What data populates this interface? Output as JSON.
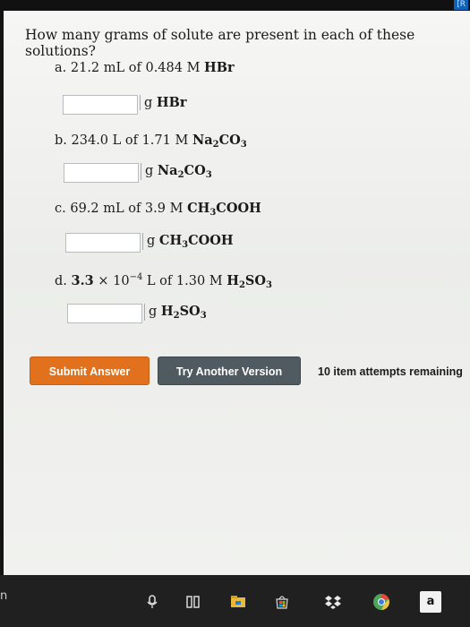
{
  "top_badge": "[R",
  "question": "How many grams of solute are present in each of these solutions?",
  "parts": [
    {
      "letter": "a.",
      "text_before": "21.2 mL of 0.484 M",
      "solute_html": "<b>HBr</b>",
      "answer_value": "",
      "unit_html": "g <b>HBr</b>"
    },
    {
      "letter": "b.",
      "text_before": "234.0 L of 1.71 M",
      "solute_html": "<b>Na<sub>2</sub>CO<sub>3</sub></b>",
      "answer_value": "",
      "unit_html": "g <b>Na<sub>2</sub>CO<sub>3</sub></b>"
    },
    {
      "letter": "c.",
      "text_before": "69.2 mL of 3.9 M",
      "solute_html": "<b>CH<sub>3</sub>COOH</b>",
      "answer_value": "",
      "unit_html": "g <b>CH<sub>3</sub>COOH</b>"
    },
    {
      "letter": "d.",
      "text_before_html": "<b>3.3</b> × 10<sup>−4</sup> L of 1.30 M",
      "solute_html": "<b>H<sub>2</sub>SO<sub>3</sub></b>",
      "answer_value": "",
      "unit_html": "g <b>H<sub>2</sub>SO<sub>3</sub></b>"
    }
  ],
  "buttons": {
    "submit": "Submit Answer",
    "try_another": "Try Another Version"
  },
  "attempts_text": "10 item attempts remaining",
  "colors": {
    "submit_bg": "#e2711d",
    "version_bg": "#505b61",
    "page_bg": "#f1f2ef"
  },
  "taskbar": {
    "left_fragment": "n",
    "icons": [
      "microphone-icon",
      "task-view-icon",
      "file-explorer-icon",
      "store-icon",
      "dropbox-icon",
      "chrome-icon",
      "amazon-icon"
    ],
    "amazon_letter": "a"
  }
}
